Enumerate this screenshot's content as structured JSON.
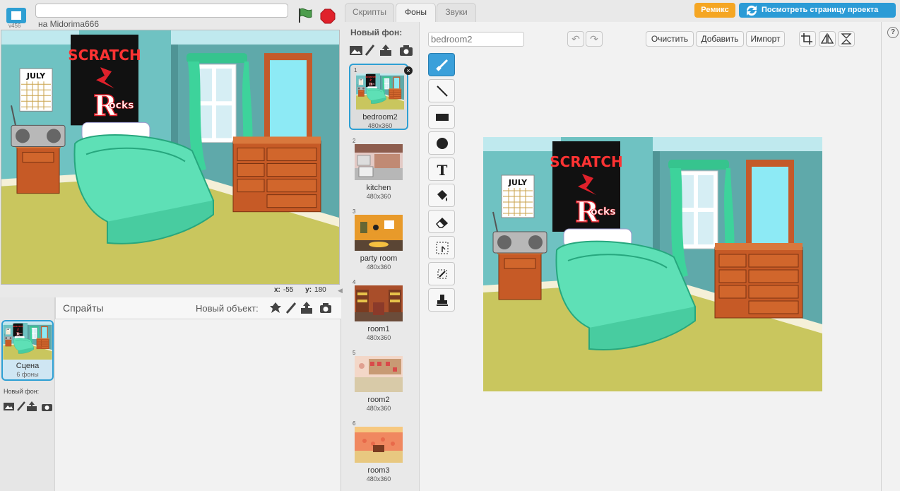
{
  "topbar": {
    "version": "v456",
    "author": "на Midorima666",
    "project_title": ""
  },
  "stage_info": {
    "x_label": "x:",
    "x_value": "-55",
    "y_label": "y:",
    "y_value": "180"
  },
  "sprites": {
    "label": "Спрайты",
    "new_object_label": "Новый объект:",
    "stage_name": "Сцена",
    "stage_backdrops": "6 фоны",
    "stage_new_backdrop": "Новый фон:"
  },
  "tabs": [
    {
      "label": "Скрипты"
    },
    {
      "label": "Фоны"
    },
    {
      "label": "Звуки"
    }
  ],
  "actions": {
    "remix": "Ремикс",
    "see_project_page": "Посмотреть страницу проекта"
  },
  "backdrops": {
    "new_label": "Новый фон:",
    "items": [
      {
        "num": "1",
        "name": "bedroom2",
        "size": "480x360"
      },
      {
        "num": "2",
        "name": "kitchen",
        "size": "480x360"
      },
      {
        "num": "3",
        "name": "party room",
        "size": "480x360"
      },
      {
        "num": "4",
        "name": "room1",
        "size": "480x360"
      },
      {
        "num": "5",
        "name": "room2",
        "size": "480x360"
      },
      {
        "num": "6",
        "name": "room3",
        "size": "480x360"
      }
    ]
  },
  "editor": {
    "costume_name": "bedroom2",
    "clear": "Очистить",
    "add": "Добавить",
    "import": "Импорт",
    "tools": [
      "brush-icon",
      "line-icon",
      "rectangle-icon",
      "ellipse-icon",
      "text-icon",
      "fill-icon",
      "eraser-icon",
      "select-icon",
      "magic-select-icon",
      "stamp-icon"
    ]
  },
  "poster": {
    "line1": "SCRATCH",
    "line2": "R",
    "line3": "OCKS"
  },
  "calendar": {
    "month": "JULY"
  },
  "colors": {
    "accent_blue": "#2b9bd6",
    "remix_orange": "#f5a623",
    "stop_red": "#e0212b",
    "flag_green": "#4c9d4c",
    "wall": "#78c4c4",
    "floor": "#c9c65e",
    "bed": "#5ee0b6"
  }
}
